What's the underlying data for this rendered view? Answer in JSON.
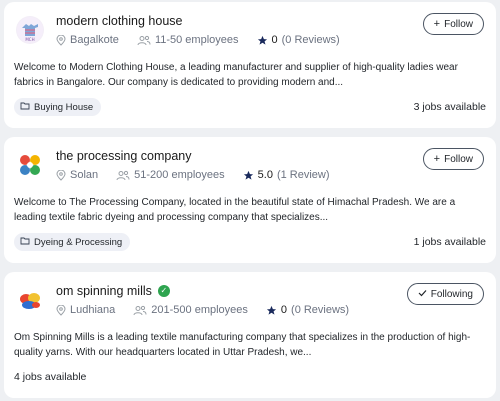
{
  "companies": [
    {
      "name": "modern clothing house",
      "location": "Bagalkote",
      "employees": "11-50 employees",
      "rating": "0",
      "reviews": "(0 Reviews)",
      "follow_label": "Follow",
      "description": "Welcome to Modern Clothing House, a leading manufacturer and supplier of high-quality ladies wear fabrics in Bangalore. Our company is dedicated to providing modern and...",
      "tag": "Buying House",
      "jobs": "3 jobs available"
    },
    {
      "name": "the processing company",
      "location": "Solan",
      "employees": "51-200 employees",
      "rating": "5.0",
      "reviews": "(1 Review)",
      "follow_label": "Follow",
      "description": "Welcome to The Processing Company, located in the beautiful state of Himachal Pradesh. We are a leading textile fabric dyeing and processing company that specializes...",
      "tag": "Dyeing & Processing",
      "jobs": "1 jobs available"
    },
    {
      "name": "om spinning mills",
      "location": "Ludhiana",
      "employees": "201-500 employees",
      "rating": "0",
      "reviews": "(0 Reviews)",
      "follow_label": "Following",
      "verified": true,
      "description": "Om Spinning Mills is a leading textile manufacturing company that specializes in the production of high-quality yarns. With our headquarters located in Uttar Pradesh, we...",
      "jobs": "4 jobs available"
    }
  ],
  "colors": {
    "background": "#eef0f3",
    "card": "#ffffff",
    "star": "#1a2a5c",
    "verified": "#2ea44f",
    "tag_bg": "#eef0f6"
  }
}
